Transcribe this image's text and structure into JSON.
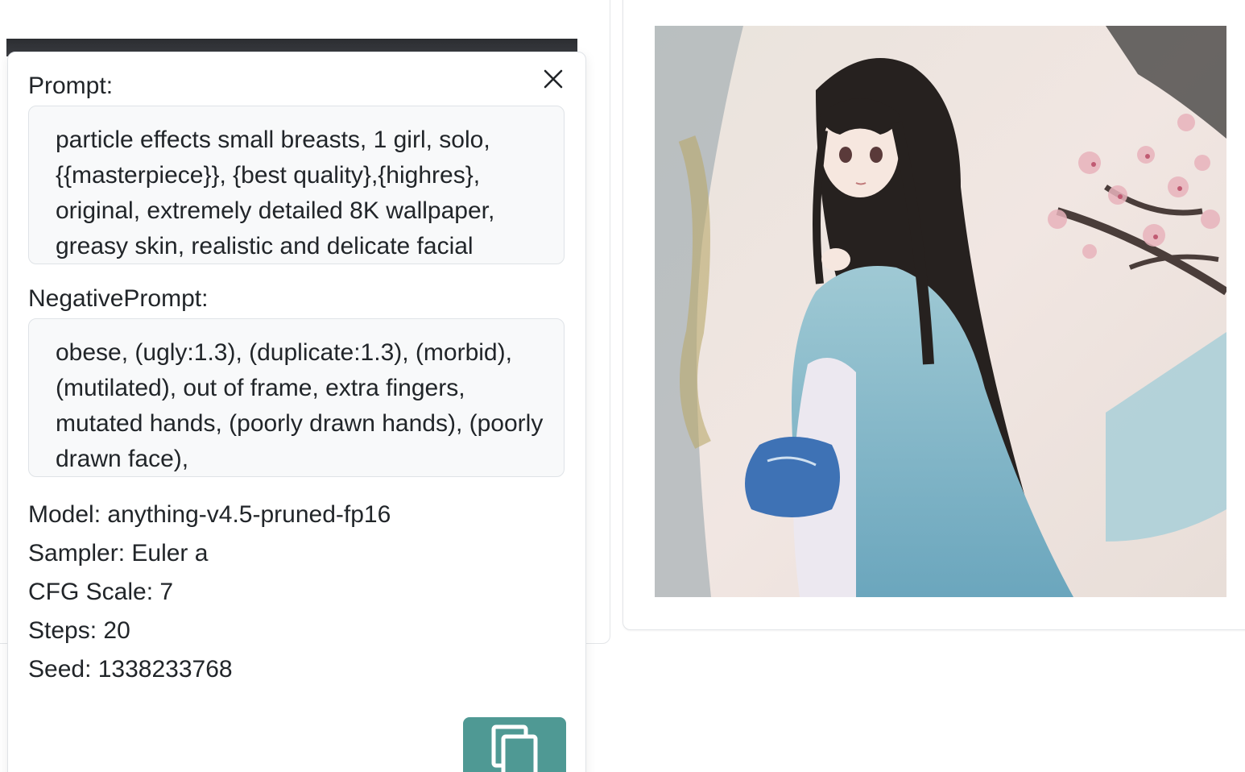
{
  "popover": {
    "prompt_label": "Prompt:",
    "prompt_text": "particle effects small breasts, 1 girl, solo, {{masterpiece}}, {best quality},{highres}, original, extremely detailed 8K wallpaper, greasy skin, realistic and delicate facial",
    "negative_label": "NegativePrompt:",
    "negative_text": "obese, (ugly:1.3), (duplicate:1.3), (morbid), (mutilated), out of frame, extra fingers, mutated hands, (poorly drawn hands), (poorly drawn face),",
    "model": "Model: anything-v4.5-pruned-fp16",
    "sampler": "Sampler: Euler a",
    "cfg": "CFG Scale: 7",
    "steps": "Steps: 20",
    "seed": "Seed: 1338233768"
  },
  "icons": {
    "close": "close-icon",
    "copy": "copy-icon"
  },
  "colors": {
    "copy_button": "#4f9994",
    "textbox_bg": "#f8f9fa"
  }
}
